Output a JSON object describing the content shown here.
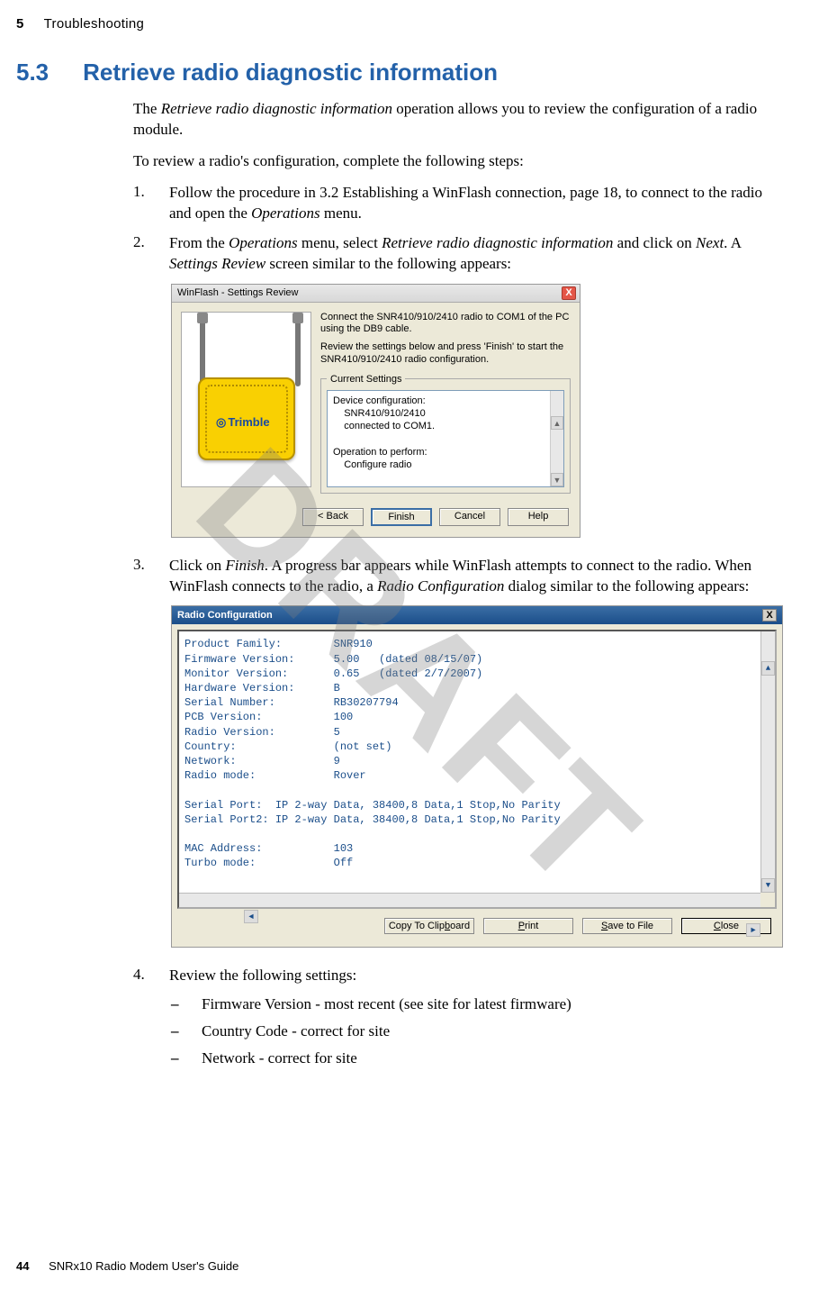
{
  "header": {
    "chapter_num": "5",
    "chapter_title": "Troubleshooting"
  },
  "section": {
    "number": "5.3",
    "title": "Retrieve radio diagnostic information"
  },
  "intro": {
    "p1_a": "The ",
    "p1_i": "Retrieve radio diagnostic information",
    "p1_b": " operation allows you to review the configuration of a radio module.",
    "p2": "To review a radio's configuration, complete the following steps:"
  },
  "steps": {
    "s1_num": "1.",
    "s1_a": "Follow the procedure in 3.2 Establishing a WinFlash connection, page 18, to connect to the radio and open the ",
    "s1_i": "Operations",
    "s1_b": " menu.",
    "s2_num": "2.",
    "s2_a": "From the ",
    "s2_i1": "Operations",
    "s2_b": " menu, select ",
    "s2_i2": "Retrieve radio diagnostic information",
    "s2_c": " and click on ",
    "s2_i3": "Next",
    "s2_d": ". A ",
    "s2_i4": "Settings Review",
    "s2_e": " screen similar to the following appears:",
    "s3_num": "3.",
    "s3_a": "Click on ",
    "s3_i1": "Finish",
    "s3_b": ". A progress bar appears while WinFlash attempts to connect to the radio. When WinFlash connects to the radio, a ",
    "s3_i2": "Radio Configuration",
    "s3_c": " dialog similar to the following appears:",
    "s4_num": "4.",
    "s4_a": "Review the following settings:"
  },
  "sublist": {
    "i1": "Firmware Version - most recent (see site for latest firmware)",
    "i2": "Country Code  - correct for site",
    "i3": "Network - correct for site",
    "dash": "–"
  },
  "dlg_sr": {
    "title": "WinFlash - Settings Review",
    "close": "X",
    "instr1": "Connect the SNR410/910/2410 radio to COM1 of the PC using the DB9 cable.",
    "instr2": "Review the settings below and press 'Finish' to start the SNR410/910/2410 radio configuration.",
    "cs_legend": "Current Settings",
    "cs_text": "Device configuration:\n    SNR410/910/2410\n    connected to COM1.\n\nOperation to perform:\n    Configure radio",
    "logo": "Trimble",
    "btn_back": "< Back",
    "btn_finish": "Finish",
    "btn_cancel": "Cancel",
    "btn_help": "Help"
  },
  "dlg_rc": {
    "title": "Radio Configuration",
    "close": "X",
    "text": "Product Family:        SNR910\nFirmware Version:      5.00   (dated 08/15/07)\nMonitor Version:       0.65   (dated 2/7/2007)\nHardware Version:      B\nSerial Number:         RB30207794\nPCB Version:           100\nRadio Version:         5\nCountry:               (not set)\nNetwork:               9\nRadio mode:            Rover\n\nSerial Port:  IP 2-way Data, 38400,8 Data,1 Stop,No Parity\nSerial Port2: IP 2-way Data, 38400,8 Data,1 Stop,No Parity\n\nMAC Address:           103\nTurbo mode:            Off",
    "btn_copy_pre": "Copy To Clip",
    "btn_copy_u": "b",
    "btn_copy_post": "oard",
    "btn_print_u": "P",
    "btn_print_post": "rint",
    "btn_save_u": "S",
    "btn_save_post": "ave to File",
    "btn_close_u": "C",
    "btn_close_post": "lose"
  },
  "footer": {
    "page": "44",
    "doc": "SNRx10 Radio Modem User's Guide"
  },
  "watermark": "DRAFT"
}
